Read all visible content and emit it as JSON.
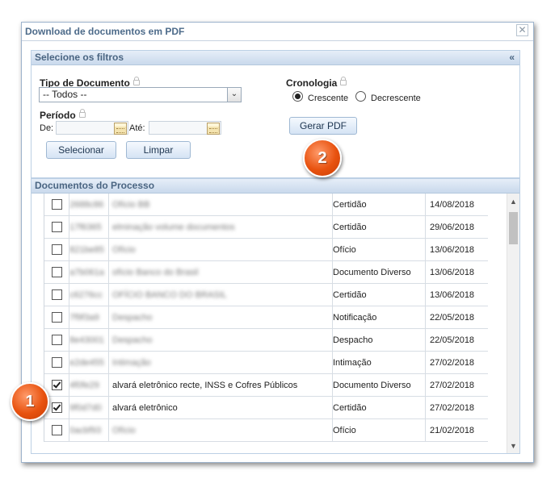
{
  "dialog": {
    "title": "Download de documentos em PDF",
    "close_glyph": "✕"
  },
  "filters": {
    "header": "Selecione os filtros",
    "collapse_glyph": "«",
    "tipo_label": "Tipo de Documento",
    "tipo_value": "-- Todos --",
    "periodo_label": "Período",
    "de_label": "De:",
    "ate_label": "Até:",
    "selecionar_label": "Selecionar",
    "limpar_label": "Limpar",
    "cronologia_label": "Cronologia",
    "crescente_label": "Crescente",
    "decrescente_label": "Decrescente",
    "selected_order": "Crescente",
    "gerar_label": "Gerar PDF"
  },
  "badges": {
    "one": "1",
    "two": "2"
  },
  "documents": {
    "header": "Documentos do Processo",
    "rows": [
      {
        "checked": false,
        "id": "2688c86",
        "desc": "Ofício BB",
        "desc_blurred": true,
        "type": "Certidão",
        "date": "14/08/2018"
      },
      {
        "checked": false,
        "id": "17f6365",
        "desc": "elminação volume documentos",
        "desc_blurred": true,
        "type": "Certidão",
        "date": "29/06/2018"
      },
      {
        "checked": false,
        "id": "821be85",
        "desc": "Ofício",
        "desc_blurred": true,
        "type": "Ofício",
        "date": "13/06/2018"
      },
      {
        "checked": false,
        "id": "a7b061a",
        "desc": "ofício Banco do Brasil",
        "desc_blurred": true,
        "type": "Documento Diverso",
        "date": "13/06/2018"
      },
      {
        "checked": false,
        "id": "c6276cc",
        "desc": "OFÍCIO BANCO DO BRASIL",
        "desc_blurred": true,
        "type": "Certidão",
        "date": "13/06/2018"
      },
      {
        "checked": false,
        "id": "7f9f3a9",
        "desc": "Despacho",
        "desc_blurred": true,
        "type": "Notificação",
        "date": "22/05/2018"
      },
      {
        "checked": false,
        "id": "8e43001",
        "desc": "Despacho",
        "desc_blurred": true,
        "type": "Despacho",
        "date": "22/05/2018"
      },
      {
        "checked": false,
        "id": "e2de455",
        "desc": "Intimação",
        "desc_blurred": true,
        "type": "Intimação",
        "date": "27/02/2018"
      },
      {
        "checked": true,
        "id": "4f0fe29",
        "desc": "alvará eletrônico recte, INSS e Cofres Públicos",
        "desc_blurred": false,
        "type": "Documento Diverso",
        "date": "27/02/2018"
      },
      {
        "checked": true,
        "id": "9f0d7d0",
        "desc": "alvará eletrônico",
        "desc_blurred": false,
        "type": "Certidão",
        "date": "27/02/2018"
      },
      {
        "checked": false,
        "id": "0acbf93",
        "desc": "Ofício",
        "desc_blurred": true,
        "type": "Ofício",
        "date": "21/02/2018"
      }
    ]
  },
  "scrollbar": {
    "up_glyph": "▲",
    "down_glyph": "▼"
  },
  "icons": [
    "close-icon",
    "collapse-icon",
    "chevron-down-icon",
    "calendar-icon",
    "lock-icon"
  ]
}
